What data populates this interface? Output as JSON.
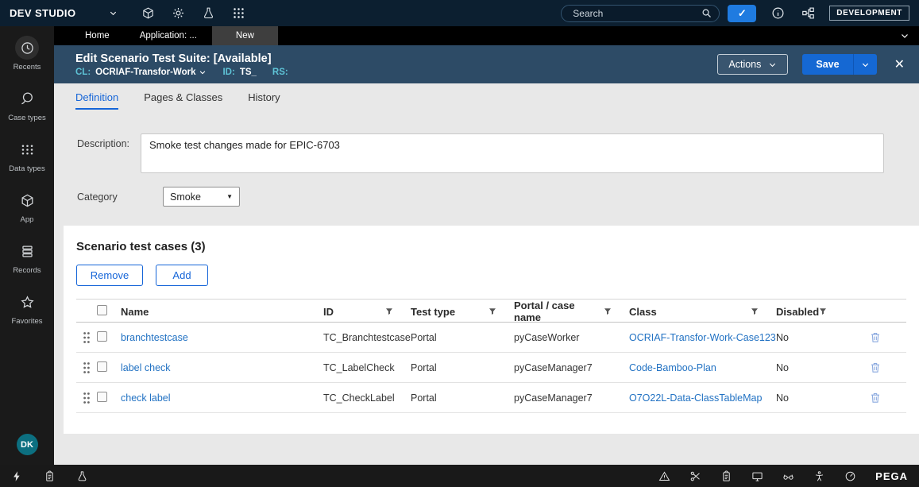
{
  "colors": {
    "accent_blue": "#1565d8",
    "link_blue": "#2272c3",
    "teal_label": "#5ec3d6",
    "topbar_bg": "#0c1f30",
    "header_band_bg": "#2d4b66"
  },
  "topbar": {
    "brand": "DEV STUDIO",
    "search_placeholder": "Search",
    "environment": "DEVELOPMENT"
  },
  "sidebar": {
    "items": [
      {
        "label": "Recents",
        "icon": "clock-icon"
      },
      {
        "label": "Case types",
        "icon": "lasso-icon"
      },
      {
        "label": "Data types",
        "icon": "dots-grid-icon"
      },
      {
        "label": "App",
        "icon": "cube-icon"
      },
      {
        "label": "Records",
        "icon": "stack-icon"
      },
      {
        "label": "Favorites",
        "icon": "star-icon"
      }
    ],
    "avatar_initials": "DK"
  },
  "browser_tabs": [
    {
      "label": "Home"
    },
    {
      "label": "Application: ..."
    },
    {
      "label": "New"
    }
  ],
  "header": {
    "title": "Edit Scenario Test Suite: [Available]",
    "cl_label": "CL:",
    "cl_value": "OCRIAF-Transfor-Work",
    "id_label": "ID:",
    "id_value": "TS_",
    "rs_label": "RS:",
    "actions_button": "Actions",
    "save_button": "Save"
  },
  "content_tabs": [
    {
      "label": "Definition"
    },
    {
      "label": "Pages & Classes"
    },
    {
      "label": "History"
    }
  ],
  "form": {
    "description_label": "Description:",
    "description_value": "Smoke test changes made for EPIC-6703",
    "category_label": "Category",
    "category_value": "Smoke"
  },
  "test_cases": {
    "title": "Scenario test cases (3)",
    "remove_button": "Remove",
    "add_button": "Add",
    "columns": {
      "name": "Name",
      "id": "ID",
      "test_type": "Test type",
      "portal": "Portal / case name",
      "class": "Class",
      "disabled": "Disabled"
    },
    "rows": [
      {
        "name": "branchtestcase",
        "id": "TC_Branchtestcase",
        "test_type": "Portal",
        "portal": "pyCaseWorker",
        "class": "OCRIAF-Transfor-Work-Case123",
        "disabled": "No"
      },
      {
        "name": "label check",
        "id": "TC_LabelCheck",
        "test_type": "Portal",
        "portal": "pyCaseManager7",
        "class": "Code-Bamboo-Plan",
        "disabled": "No"
      },
      {
        "name": "check label",
        "id": "TC_CheckLabel",
        "test_type": "Portal",
        "portal": "pyCaseManager7",
        "class": "O7O22L-Data-ClassTableMap",
        "disabled": "No"
      }
    ]
  },
  "footer": {
    "brand": "PEGA"
  }
}
